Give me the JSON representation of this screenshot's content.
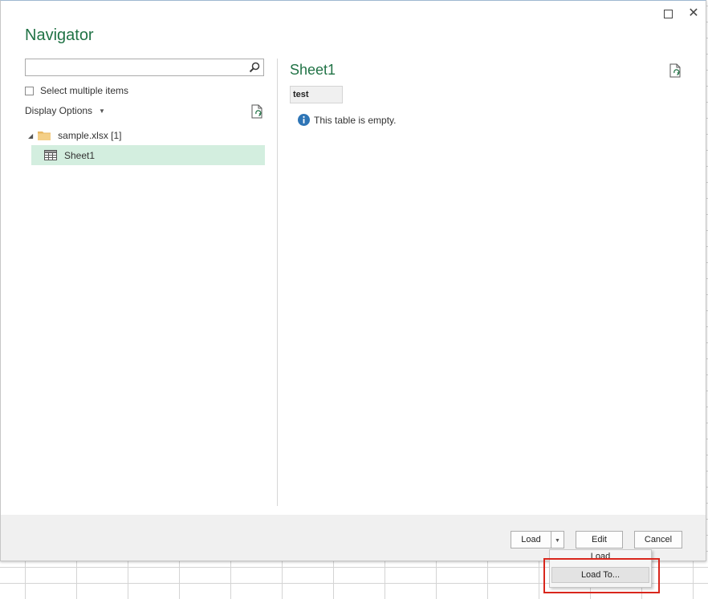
{
  "dialog": {
    "title": "Navigator"
  },
  "search": {
    "value": "",
    "placeholder": ""
  },
  "select_multiple": {
    "label": "Select multiple items",
    "checked": false
  },
  "display_options": {
    "label": "Display Options"
  },
  "tree": {
    "folder": {
      "label": "sample.xlsx [1]",
      "icon": "folder-icon"
    },
    "items": [
      {
        "label": "Sheet1",
        "icon": "table-icon",
        "selected": true
      }
    ]
  },
  "preview": {
    "title": "Sheet1",
    "column_header": "test",
    "message": "This table is empty."
  },
  "buttons": {
    "load": "Load",
    "edit": "Edit",
    "cancel": "Cancel"
  },
  "load_menu": {
    "items": [
      "Load",
      "Load To..."
    ]
  },
  "colors": {
    "accent": "#217346",
    "selected_row": "#d3eedf",
    "highlight": "#d9261c",
    "info": "#2e75b6"
  }
}
